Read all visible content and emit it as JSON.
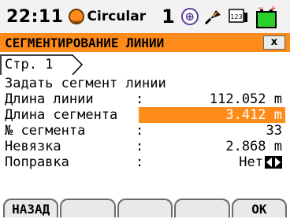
{
  "status": {
    "time": "22:11",
    "mode": "Circular",
    "face_number": "1",
    "target_glyph": "⊕",
    "icons": [
      "smiley-status-icon",
      "target-icon",
      "prism-icon",
      "keyboard-123-icon",
      "battery-icon"
    ],
    "keyboard_label": "123"
  },
  "window": {
    "title": "СЕГМЕНТИРОВАНИЕ ЛИНИИ",
    "close_label": "x"
  },
  "page_tab": "Стр.  1",
  "rows": [
    {
      "label": "Задать сегмент линии",
      "colon": "",
      "value": ""
    },
    {
      "label": "Длина линии",
      "colon": ":",
      "value": "112.052 m"
    },
    {
      "label": "Длина сегмента",
      "colon": ":",
      "value": "3.412 m"
    },
    {
      "label": "№ сегмента",
      "colon": ":",
      "value": "33"
    },
    {
      "label": "Невязка",
      "colon": ":",
      "value": "2.868 m"
    },
    {
      "label": "Поправка",
      "colon": ":",
      "value": "Нет"
    }
  ],
  "softkeys": [
    "НАЗАД",
    "",
    "",
    "",
    "OK"
  ],
  "colors": {
    "accent": "#ff8c1a",
    "selection_text": "#ffffff"
  }
}
